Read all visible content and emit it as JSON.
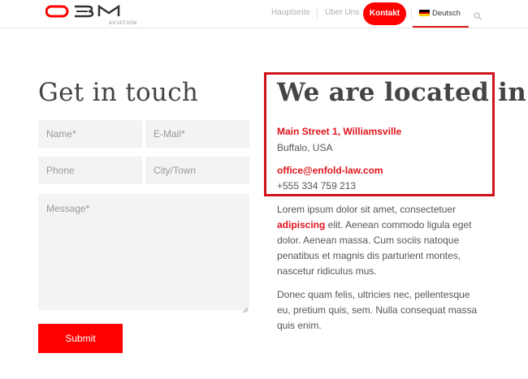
{
  "header": {
    "logo_text": "OBM",
    "logo_sub": "AVIATION",
    "nav": [
      {
        "label": "Hauptseite"
      },
      {
        "label": "Über Uns"
      },
      {
        "label": "Kontakt"
      }
    ],
    "language": "Deutsch",
    "colors": {
      "accent": "#ff0000",
      "active_underline": "#e0141c"
    }
  },
  "contact_form": {
    "heading": "Get in touch",
    "fields": {
      "name": "Name*",
      "email": "E-Mail*",
      "phone": "Phone",
      "city": "City/Town",
      "message": "Message*"
    },
    "submit": "Submit"
  },
  "location": {
    "heading": "We are located in",
    "street": "Main Street 1, Williamsville",
    "city": "Buffalo, USA",
    "email": "office@enfold-law.com",
    "phone": "+555 334 759 213",
    "para1_before": "Lorem ipsum dolor sit amet, consectetuer ",
    "para1_bold": "adipiscing",
    "para1_after": " elit. Aenean commodo ligula eget dolor. Aenean massa. Cum sociis natoque penatibus et magnis dis parturient montes, nascetur ridiculus mus.",
    "para2": "Donec quam felis, ultricies nec, pellentesque eu, pretium quis, sem. Nulla consequat massa quis enim."
  }
}
